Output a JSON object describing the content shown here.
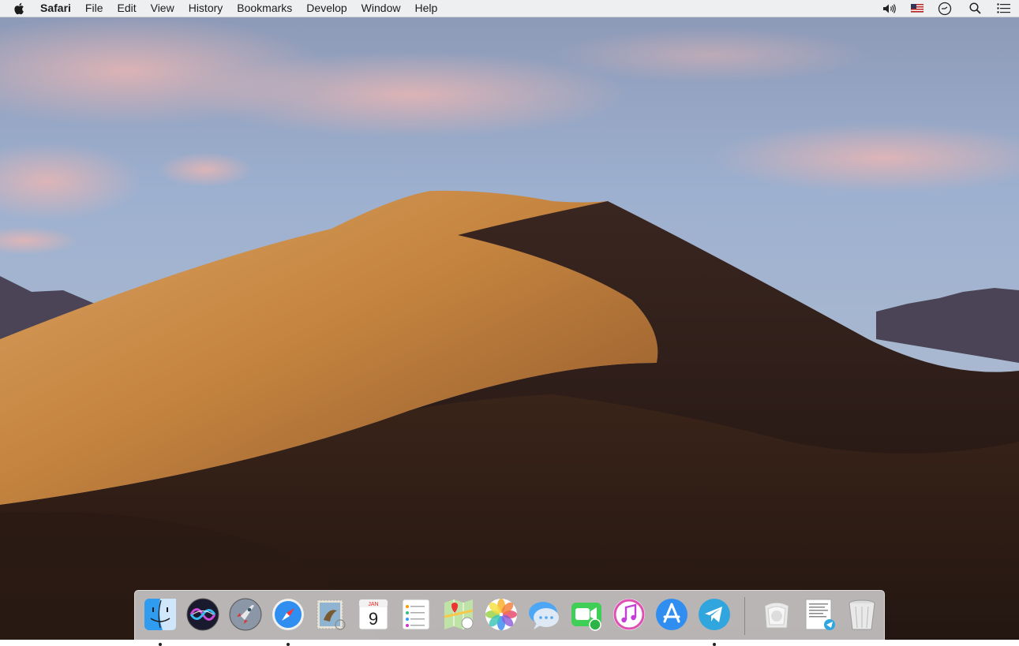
{
  "menubar": {
    "apple_icon": "apple-logo-icon",
    "app_name": "Safari",
    "menus": [
      "File",
      "Edit",
      "View",
      "History",
      "Bookmarks",
      "Develop",
      "Window",
      "Help"
    ],
    "status_icons": [
      "volume-icon",
      "us-flag-input-icon",
      "time-machine-icon",
      "spotlight-search-icon",
      "notification-center-icon"
    ]
  },
  "dock": {
    "apps": [
      {
        "name": "Finder",
        "icon": "finder-icon",
        "running": true
      },
      {
        "name": "Siri",
        "icon": "siri-icon",
        "running": false
      },
      {
        "name": "Launchpad",
        "icon": "launchpad-icon",
        "running": false
      },
      {
        "name": "Safari",
        "icon": "safari-icon",
        "running": true
      },
      {
        "name": "Mail",
        "icon": "mail-stamp-icon",
        "running": false
      },
      {
        "name": "Calendar",
        "icon": "calendar-icon",
        "running": false
      },
      {
        "name": "Reminders",
        "icon": "reminders-icon",
        "running": false
      },
      {
        "name": "Maps",
        "icon": "maps-icon",
        "running": false
      },
      {
        "name": "Photos",
        "icon": "photos-icon",
        "running": false
      },
      {
        "name": "Messages",
        "icon": "messages-icon",
        "running": false
      },
      {
        "name": "FaceTime",
        "icon": "facetime-icon",
        "running": false
      },
      {
        "name": "iTunes",
        "icon": "itunes-icon",
        "running": false
      },
      {
        "name": "App Store",
        "icon": "app-store-icon",
        "running": false
      },
      {
        "name": "Telegram",
        "icon": "telegram-icon",
        "running": true
      }
    ],
    "others": [
      {
        "name": "Downloads stack",
        "icon": "downloads-stack-icon"
      },
      {
        "name": "Document stack",
        "icon": "document-stack-icon"
      },
      {
        "name": "Trash",
        "icon": "trash-icon"
      }
    ],
    "calendar": {
      "month": "JAN",
      "day": "9"
    }
  },
  "colors": {
    "menubar_bg": "#f4f4f4",
    "dune_light": "#c98a45",
    "dune_shadow": "#2c1a14",
    "sky": "#9fb1ce"
  }
}
